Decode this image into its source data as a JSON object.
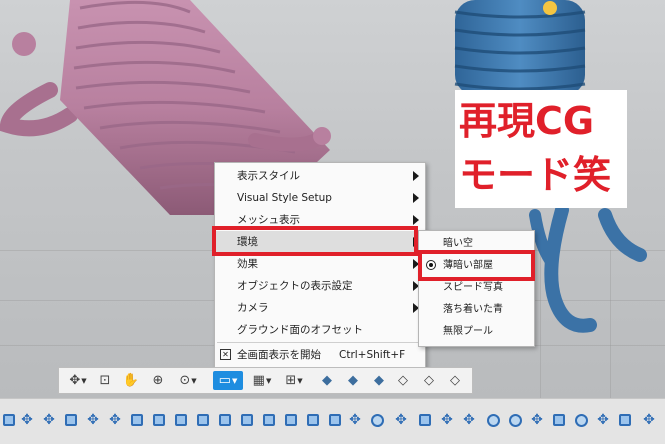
{
  "overlay_caption": {
    "line1": "再現CG",
    "line2": "モード笑"
  },
  "context_menu": {
    "items": [
      {
        "label": "表示スタイル",
        "has_submenu": true
      },
      {
        "label": "Visual Style Setup",
        "has_submenu": true
      },
      {
        "label": "メッシュ表示",
        "has_submenu": true
      },
      {
        "label": "環境",
        "has_submenu": true,
        "highlighted": true
      },
      {
        "label": "効果",
        "has_submenu": true
      },
      {
        "label": "オブジェクトの表示設定",
        "has_submenu": true
      },
      {
        "label": "カメラ",
        "has_submenu": true
      },
      {
        "label": "グラウンド面のオフセット",
        "has_submenu": false
      },
      {
        "label": "全画面表示を開始",
        "shortcut": "Ctrl+Shift+F",
        "has_submenu": false
      }
    ]
  },
  "environment_submenu": {
    "items": [
      {
        "label": "暗い空",
        "selected": false
      },
      {
        "label": "薄暗い部屋",
        "selected": true
      },
      {
        "label": "スピード写真",
        "selected": false
      },
      {
        "label": "落ち着いた青",
        "selected": false
      },
      {
        "label": "無限プール",
        "selected": false
      }
    ]
  },
  "colors": {
    "accent_red": "#e0202a",
    "pink_model": "#b8809f",
    "blue_model": "#3f78ad",
    "active_button": "#1e8de0"
  },
  "nav_toolbar": {
    "buttons": [
      {
        "icon": "orbit-icon",
        "glyph": "✥",
        "dropdown": true
      },
      {
        "icon": "pan-hand-icon",
        "glyph": "✋",
        "dropdown": false
      },
      {
        "icon": "zoom-icon",
        "glyph": "⊕",
        "dropdown": false
      },
      {
        "icon": "zoom-window-icon",
        "glyph": "⊙",
        "dropdown": true
      },
      {
        "icon": "display-settings-icon",
        "glyph": "▭",
        "dropdown": true,
        "active": true
      },
      {
        "icon": "grid-icon",
        "glyph": "▦",
        "dropdown": true
      },
      {
        "icon": "viewports-icon",
        "glyph": "⊞",
        "dropdown": true
      },
      {
        "icon": "view-cube-1-icon",
        "glyph": "◆",
        "dropdown": false
      },
      {
        "icon": "view-cube-2-icon",
        "glyph": "◆",
        "dropdown": false
      },
      {
        "icon": "view-cube-3-icon",
        "glyph": "◆",
        "dropdown": false
      },
      {
        "icon": "view-cube-wire-icon",
        "glyph": "◇",
        "dropdown": false
      },
      {
        "icon": "view-cube-outline-icon",
        "glyph": "◇",
        "dropdown": false
      },
      {
        "icon": "view-cube-plain-icon",
        "glyph": "◇",
        "dropdown": false
      }
    ]
  }
}
